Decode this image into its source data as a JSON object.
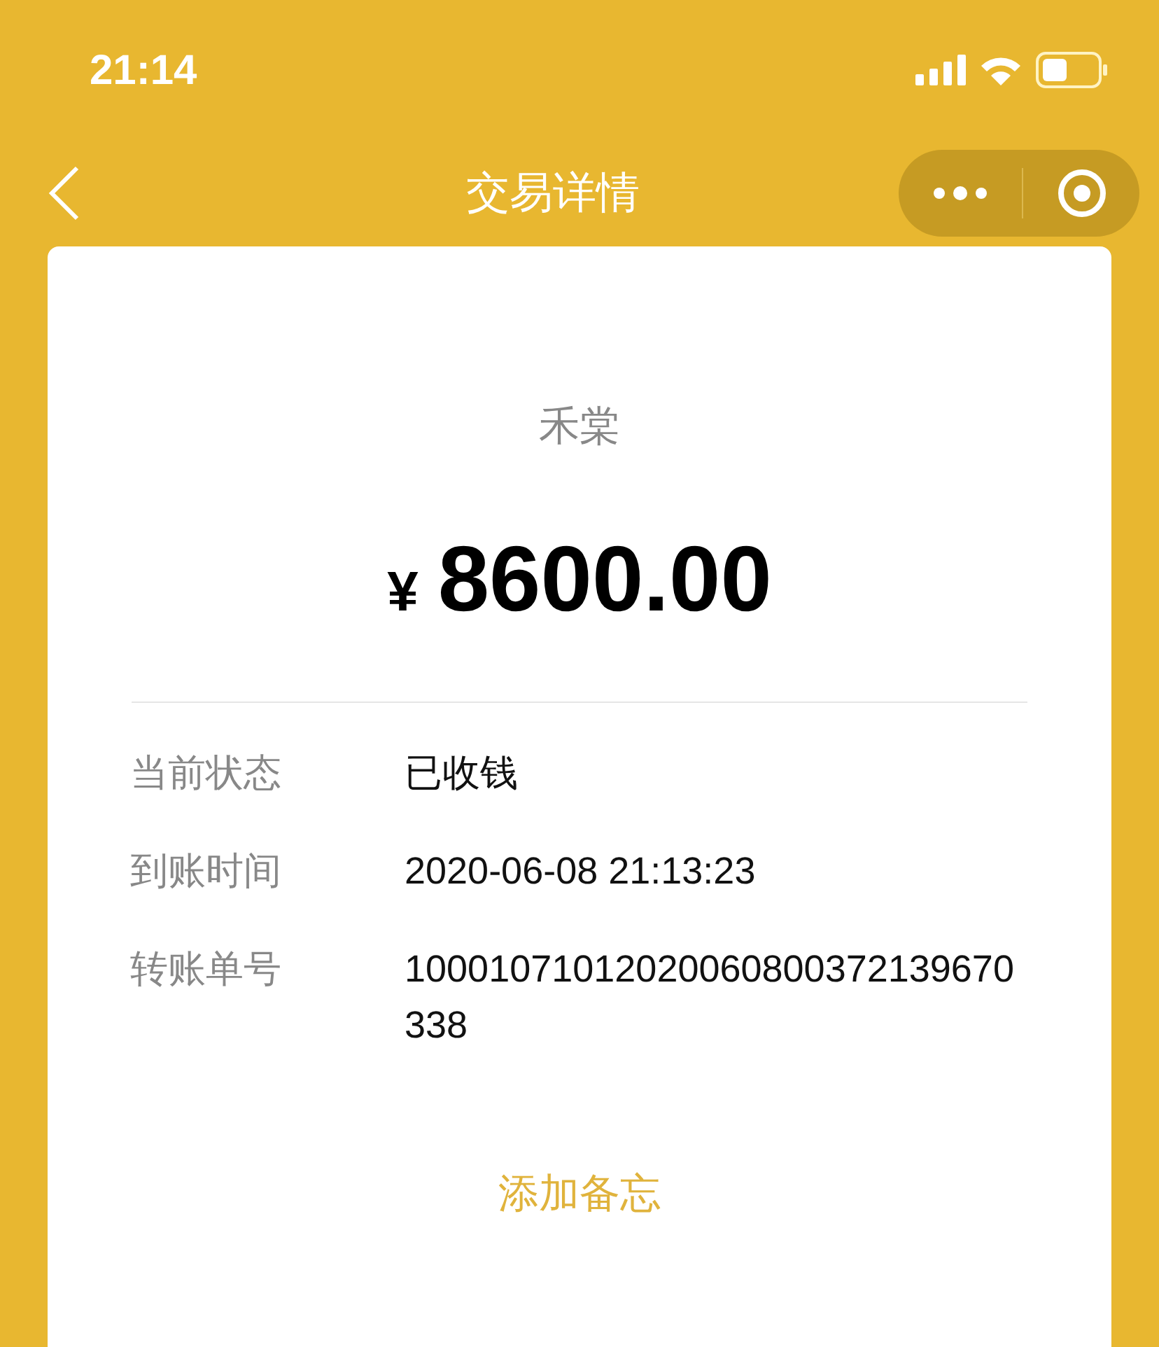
{
  "status_bar": {
    "time": "21:14"
  },
  "nav": {
    "title": "交易详情"
  },
  "payee": "禾棠",
  "amount": {
    "currency": "¥",
    "value": "8600.00"
  },
  "details": [
    {
      "label": "当前状态",
      "value": "已收钱"
    },
    {
      "label": "到账时间",
      "value": "2020-06-08 21:13:23"
    },
    {
      "label": "转账单号",
      "value": "10001071012020060800372139670338"
    }
  ],
  "note_link": "添加备忘"
}
